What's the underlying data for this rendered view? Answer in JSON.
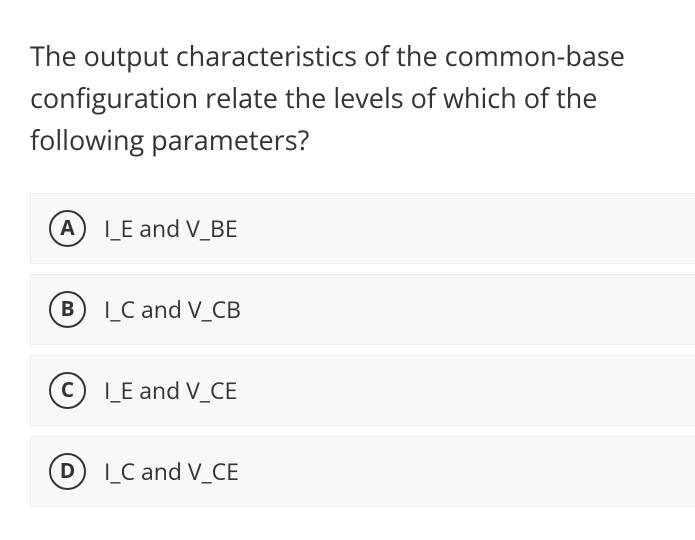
{
  "question": "The output characteristics of the common-base configuration relate the levels of which of the following parameters?",
  "options": [
    {
      "letter": "A",
      "text": "I_E and V_BE"
    },
    {
      "letter": "B",
      "text": "I_C and V_CB"
    },
    {
      "letter": "C",
      "text": "I_E and V_CE"
    },
    {
      "letter": "D",
      "text": "I_C and V_CE"
    }
  ]
}
